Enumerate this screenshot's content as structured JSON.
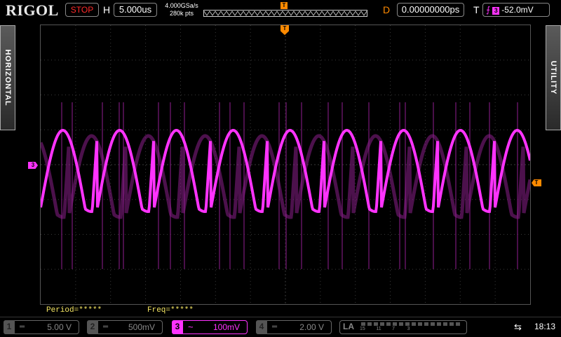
{
  "header": {
    "brand": "RIGOL",
    "run_status": "STOP",
    "horizontal_label": "H",
    "timebase": "5.000us",
    "sample_rate": "4.000GSa/s",
    "memory_depth": "280k pts",
    "trigger_position_marker": "T",
    "delay_label": "D",
    "delay_value": "0.00000000ps",
    "trigger_label": "T",
    "trigger_source": "3",
    "trigger_level": "-52.0mV"
  },
  "side_tabs": {
    "left": "HORIZONTAL",
    "right": "UTILITY"
  },
  "markers": {
    "channel3": "3",
    "trigger_top": "T",
    "trigger_level": "T"
  },
  "measurements": {
    "period": "Period=*****",
    "freq": "Freq=*****"
  },
  "channels": [
    {
      "num": "1",
      "coupling": "═",
      "scale": "5.00 V",
      "active": false
    },
    {
      "num": "2",
      "coupling": "═",
      "scale": "500mV",
      "active": false
    },
    {
      "num": "3",
      "coupling": "~",
      "scale": "100mV",
      "active": true
    },
    {
      "num": "4",
      "coupling": "═",
      "scale": "2.00 V",
      "active": false
    }
  ],
  "logic_analyzer": {
    "label": "LA",
    "groups": "15        11        7         3"
  },
  "status": {
    "clock": "18:13"
  },
  "colors": {
    "ch3": "#ff33ff",
    "trigger": "#ff8a00",
    "stop": "#ff2a2a",
    "measure": "#f5e663"
  }
}
